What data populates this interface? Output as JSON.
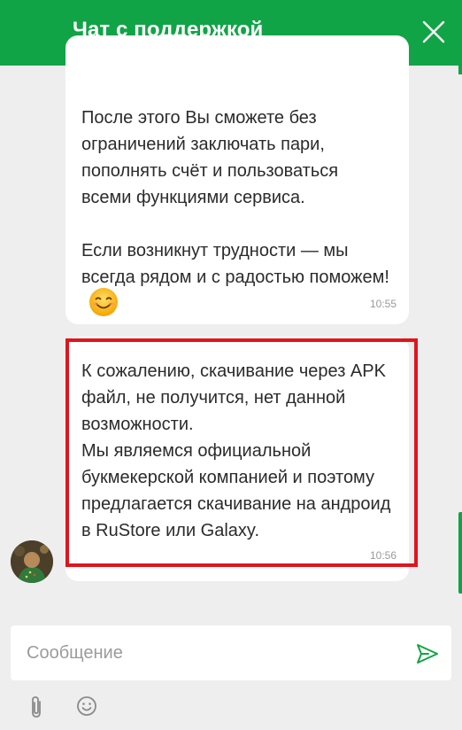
{
  "header": {
    "title": "Чат с поддержкой",
    "close_icon": "close-icon",
    "accent_color": "#11a446"
  },
  "messages": [
    {
      "paragraphs": [
        "После этого Вы сможете без ограничений заключать пари, пополнять счёт и пользоваться всеми функциями сервиса.",
        "Если возникнут трудности — мы всегда рядом и с радостью поможем!"
      ],
      "emoji": "smiling-face-emoji",
      "time": "10:55"
    },
    {
      "paragraphs": [
        "К сожалению, скачивание через APK файл, не получится, нет данной возможности.",
        "Мы являемся официальной букмекерской компанией и поэтому предлагается скачивание на андроид в RuStore или Galaxy."
      ],
      "time": "10:56",
      "highlight_color": "#e0151b"
    }
  ],
  "composer": {
    "placeholder": "Сообщение",
    "send_icon": "send-icon",
    "attach_icon": "paperclip-icon",
    "emoji_icon": "smiley-icon"
  }
}
